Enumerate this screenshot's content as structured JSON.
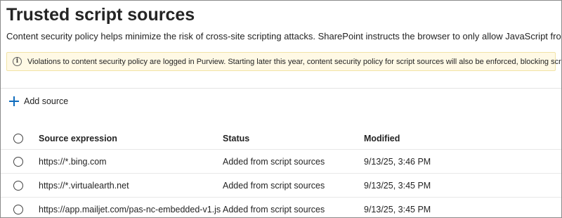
{
  "page": {
    "title": "Trusted script sources",
    "description": "Content security policy helps minimize the risk of cross-site scripting attacks. SharePoint instructs the browser to only allow JavaScript from these sources. An attacker"
  },
  "banner": {
    "icon": "info-icon",
    "text": "Violations to content security policy are logged in Purview. Starting later this year, content security policy for script sources will also be enforced, blocking scripts from untrusted sources.",
    "background": "#fff9e5"
  },
  "toolbar": {
    "add_label": "Add source",
    "add_icon": "plus-icon",
    "accent": "#0f6cbd"
  },
  "table": {
    "columns": {
      "source": "Source expression",
      "status": "Status",
      "modified": "Modified"
    },
    "rows": [
      {
        "source": "https://*.bing.com",
        "status": "Added from script sources",
        "modified": "9/13/25, 3:46 PM"
      },
      {
        "source": "https://*.virtualearth.net",
        "status": "Added from script sources",
        "modified": "9/13/25, 3:45 PM"
      },
      {
        "source": "https://app.mailjet.com/pas-nc-embedded-v1.js",
        "status": "Added from script sources",
        "modified": "9/13/25, 3:45 PM"
      }
    ]
  }
}
